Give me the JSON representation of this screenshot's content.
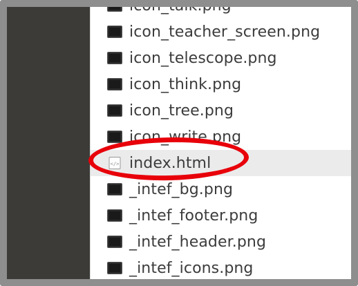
{
  "files": [
    {
      "name": "icon_talk.png",
      "icon": "image-file-icon",
      "selected": false
    },
    {
      "name": "icon_teacher_screen.png",
      "icon": "image-file-icon",
      "selected": false
    },
    {
      "name": "icon_telescope.png",
      "icon": "image-file-icon",
      "selected": false
    },
    {
      "name": "icon_think.png",
      "icon": "image-file-icon",
      "selected": false
    },
    {
      "name": "icon_tree.png",
      "icon": "image-file-icon",
      "selected": false
    },
    {
      "name": "icon_write.png",
      "icon": "image-file-icon",
      "selected": false
    },
    {
      "name": "index.html",
      "icon": "html-file-icon",
      "selected": true
    },
    {
      "name": "_intef_bg.png",
      "icon": "image-file-icon",
      "selected": false
    },
    {
      "name": "_intef_footer.png",
      "icon": "image-file-icon",
      "selected": false
    },
    {
      "name": "_intef_header.png",
      "icon": "image-file-icon",
      "selected": false
    },
    {
      "name": "_intef_icons.png",
      "icon": "image-file-icon",
      "selected": false
    }
  ],
  "colors": {
    "sidebar": "#3c3b37",
    "highlight": "#e8000a",
    "selected_row": "#ebebeb",
    "frame": "#8e8e8e"
  },
  "annotation": {
    "shape": "ellipse",
    "target": "index.html"
  }
}
